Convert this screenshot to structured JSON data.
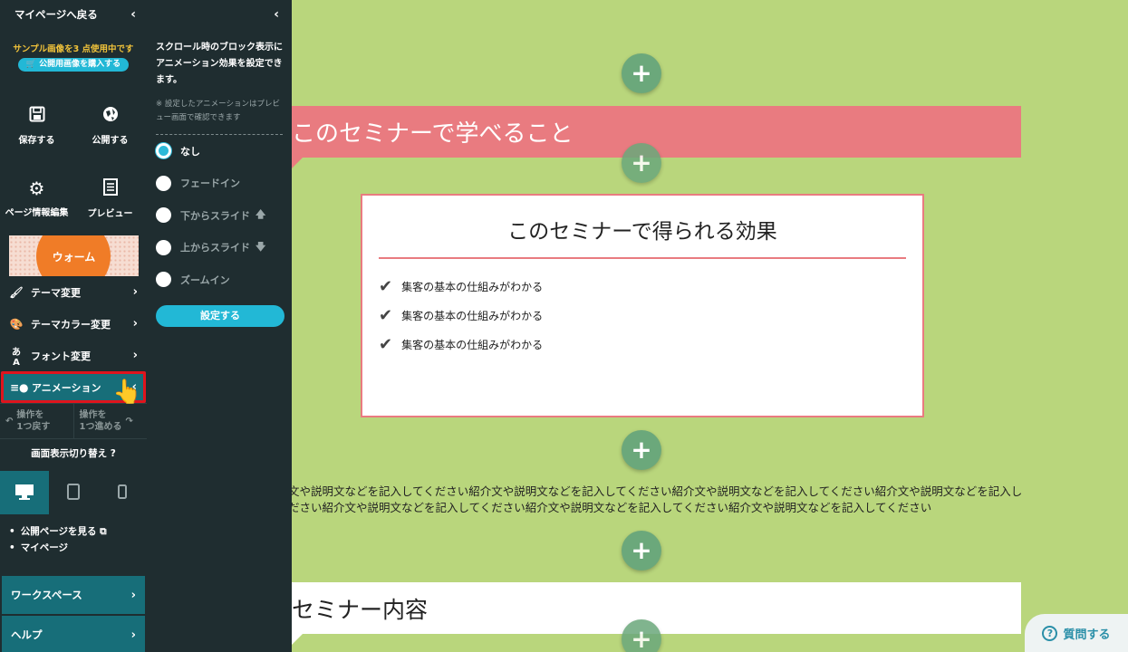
{
  "sidebar": {
    "back_label": "マイページへ戻る",
    "sample_note": "サンプル画像を3 点使用中です",
    "buy_label": "公開用画像を購入する",
    "buttons": [
      {
        "label": "保存する",
        "icon": "save-icon"
      },
      {
        "label": "公開する",
        "icon": "publish-icon"
      },
      {
        "label": "ページ情報編集",
        "icon": "gear-icon"
      },
      {
        "label": "プレビュー",
        "icon": "preview-icon"
      }
    ],
    "theme_label": "ウォーム",
    "menu": [
      {
        "label": "テーマ変更"
      },
      {
        "label": "テーマカラー変更"
      },
      {
        "label": "フォント変更"
      },
      {
        "label": "アニメーション"
      }
    ],
    "undo_label": "操作を 1つ戻す",
    "redo_label": "操作を 1つ進める",
    "undo_line1": "操作を",
    "undo_line2": "1つ戻す",
    "redo_line1": "操作を",
    "redo_line2": "1つ進める",
    "display_title": "画面表示切り替え",
    "links": [
      "公開ページを見る",
      "マイページ"
    ],
    "workspace_label": "ワークスペース",
    "help_label": "ヘルプ"
  },
  "anim_panel": {
    "description": "スクロール時のブロック表示にアニメーション効果を設定できます。",
    "note": "※ 設定したアニメーションはプレビュー画面で確認できます",
    "options": [
      {
        "label": "なし",
        "selected": true
      },
      {
        "label": "フェードイン",
        "selected": false
      },
      {
        "label": "下からスライド",
        "selected": false
      },
      {
        "label": "上からスライド",
        "selected": false
      },
      {
        "label": "ズームイン",
        "selected": false
      }
    ],
    "apply_label": "設定する"
  },
  "canvas": {
    "section1_title": "このセミナーで学べること",
    "effect_title": "このセミナーで得られる効果",
    "effect_items": [
      "集客の基本の仕組みがわかる",
      "集客の基本の仕組みがわかる",
      "集客の基本の仕組みがわかる"
    ],
    "intro_line1": "文や説明文などを記入してください紹介文や説明文などを記入してください紹介文や説明文などを記入してください紹介文や説明文などを記入し",
    "intro_line2": "ださい紹介文や説明文などを記入してください紹介文や説明文などを記入してください紹介文や説明文などを記入してください",
    "section2_title": "セミナー内容",
    "help_button": "質問する"
  },
  "colors": {
    "canvas_bg": "#b9d67c",
    "sidebar_bg": "#1f2d30",
    "accent": "#22b8d6",
    "pink": "#e97b80",
    "active_menu": "#176e79",
    "highlight_border": "#e0141d"
  }
}
